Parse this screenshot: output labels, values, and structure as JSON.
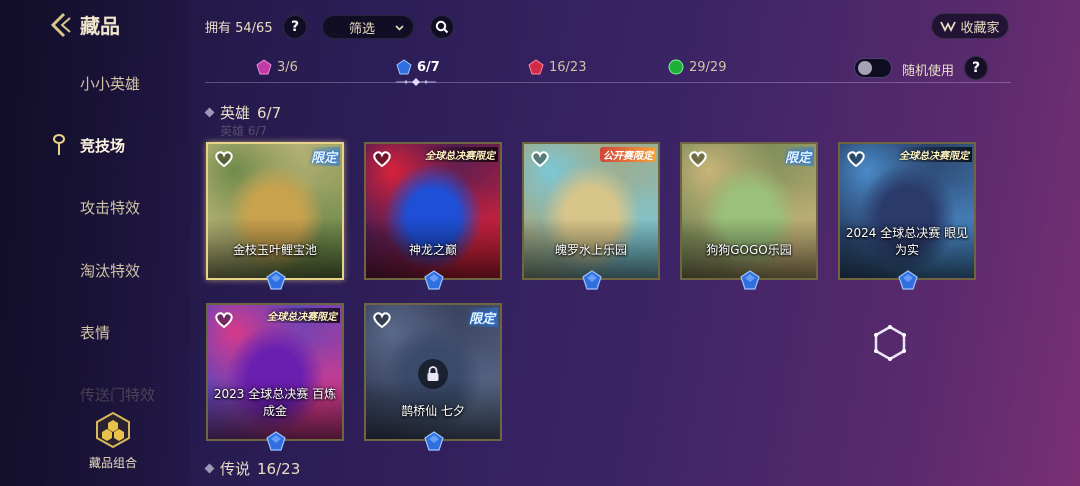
{
  "header": {
    "title": "藏品",
    "owned": "拥有 54/65",
    "help": "?",
    "filter_label": "筛选",
    "collector_label": "收藏家"
  },
  "sidebar": {
    "items": [
      {
        "label": "小小英雄"
      },
      {
        "label": "竞技场"
      },
      {
        "label": "攻击特效"
      },
      {
        "label": "淘汰特效"
      },
      {
        "label": "表情"
      },
      {
        "label": "传送门特效"
      }
    ],
    "active_index": 1,
    "combo_label": "藏品组合"
  },
  "rarity_tabs": [
    {
      "count": "3/6",
      "gem": "purple",
      "color": "#c13aa6"
    },
    {
      "count": "6/7",
      "gem": "blue",
      "color": "#2f6fe0"
    },
    {
      "count": "16/23",
      "gem": "red",
      "color": "#d42a4a"
    },
    {
      "count": "29/29",
      "gem": "green",
      "color": "#1fae3a"
    }
  ],
  "random": {
    "label": "随机使用",
    "on": false,
    "help": "?"
  },
  "sections": [
    {
      "title": "英雄",
      "count": "6/7",
      "ghost": "英雄 6/7"
    },
    {
      "title": "传说",
      "count": "16/23"
    }
  ],
  "cards": [
    {
      "name": "金枝玉叶鲤宝池",
      "tag": "限定",
      "tag_type": "limited",
      "selected": true,
      "locked": false,
      "palette": [
        "#c9a24e",
        "#6f8a4a",
        "#d8c58a"
      ]
    },
    {
      "name": "神龙之巅",
      "tag": "全球总决赛限定",
      "tag_type": "worlds",
      "selected": false,
      "locked": false,
      "palette": [
        "#1e4fd6",
        "#d8223a",
        "#0b1a5e"
      ]
    },
    {
      "name": "魄罗水上乐园",
      "tag": "公开赛限定",
      "tag_type": "open",
      "selected": false,
      "locked": false,
      "palette": [
        "#d7c58a",
        "#7cc7d6",
        "#b49a5a"
      ]
    },
    {
      "name": "狗狗GOGO乐园",
      "tag": "限定",
      "tag_type": "limited",
      "selected": false,
      "locked": false,
      "palette": [
        "#9bc07a",
        "#c9b57a",
        "#5a7a4a"
      ]
    },
    {
      "name": "2024 全球总决赛 眼见为实",
      "tag": "全球总决赛限定",
      "tag_type": "worlds",
      "selected": false,
      "locked": false,
      "palette": [
        "#2a3a6a",
        "#4a8ac8",
        "#1a1f3a"
      ]
    },
    {
      "name": "2023 全球总决赛 百炼成金",
      "tag": "全球总决赛限定",
      "tag_type": "worlds",
      "selected": false,
      "locked": false,
      "palette": [
        "#6a1fb0",
        "#d83a8a",
        "#2a4ad0"
      ]
    },
    {
      "name": "鹊桥仙 七夕",
      "tag": "限定",
      "tag_type": "limited",
      "selected": false,
      "locked": true,
      "palette": [
        "#3a4a6a",
        "#5a6a8a",
        "#2a2f4a"
      ]
    }
  ]
}
